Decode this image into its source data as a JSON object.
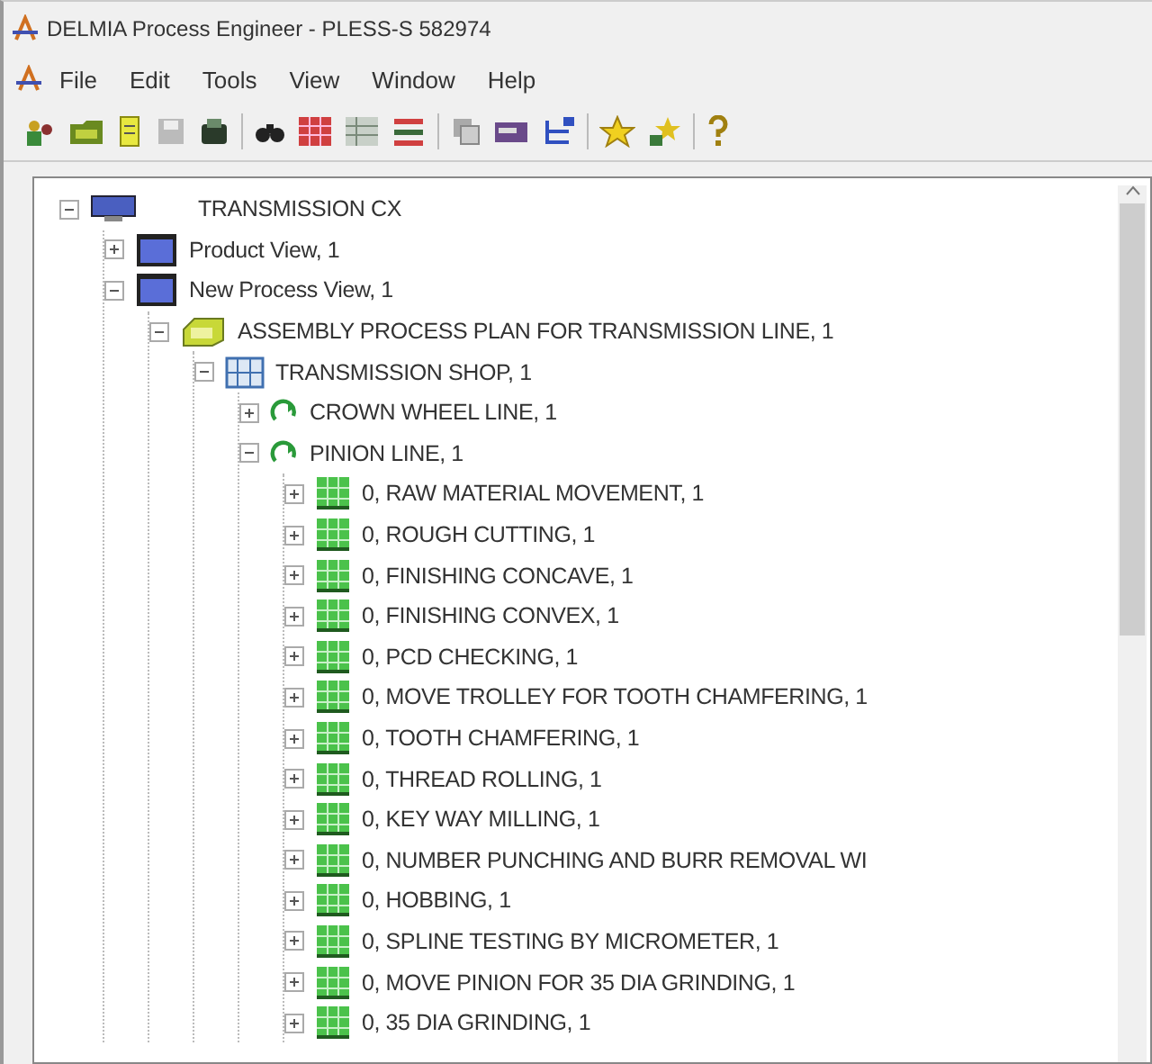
{
  "window": {
    "title": "DELMIA Process Engineer - PLESS-S 582974"
  },
  "menu": [
    {
      "label": "File"
    },
    {
      "label": "Edit"
    },
    {
      "label": "Tools"
    },
    {
      "label": "View"
    },
    {
      "label": "Window"
    },
    {
      "label": "Help"
    }
  ],
  "tree": [
    {
      "label": "TRANSMISSION CX",
      "kind": "root",
      "expanded": true,
      "children": [
        {
          "label": "Product View, 1",
          "kind": "folder",
          "expanded": false
        },
        {
          "label": "New Process View, 1",
          "kind": "folder",
          "expanded": true,
          "children": [
            {
              "label": "ASSEMBLY PROCESS PLAN FOR TRANSMISSION LINE, 1",
              "kind": "plan",
              "expanded": true,
              "children": [
                {
                  "label": "TRANSMISSION SHOP, 1",
                  "kind": "shop",
                  "expanded": true,
                  "children": [
                    {
                      "label": "CROWN WHEEL LINE, 1",
                      "kind": "line",
                      "expanded": false
                    },
                    {
                      "label": "PINION LINE, 1",
                      "kind": "line",
                      "expanded": true,
                      "children": [
                        {
                          "label": "0, RAW MATERIAL MOVEMENT, 1",
                          "kind": "operation",
                          "expanded": false
                        },
                        {
                          "label": "0, ROUGH CUTTING, 1",
                          "kind": "operation",
                          "expanded": false
                        },
                        {
                          "label": "0, FINISHING CONCAVE, 1",
                          "kind": "operation",
                          "expanded": false
                        },
                        {
                          "label": "0, FINISHING CONVEX, 1",
                          "kind": "operation",
                          "expanded": false
                        },
                        {
                          "label": "0, PCD CHECKING, 1",
                          "kind": "operation",
                          "expanded": false
                        },
                        {
                          "label": "0, MOVE TROLLEY FOR TOOTH CHAMFERING, 1",
                          "kind": "operation",
                          "expanded": false
                        },
                        {
                          "label": "0, TOOTH CHAMFERING, 1",
                          "kind": "operation",
                          "expanded": false
                        },
                        {
                          "label": "0, THREAD ROLLING, 1",
                          "kind": "operation",
                          "expanded": false
                        },
                        {
                          "label": "0, KEY WAY MILLING, 1",
                          "kind": "operation",
                          "expanded": false
                        },
                        {
                          "label": "0, NUMBER PUNCHING AND BURR REMOVAL WI",
                          "kind": "operation",
                          "expanded": false
                        },
                        {
                          "label": "0, HOBBING, 1",
                          "kind": "operation",
                          "expanded": false
                        },
                        {
                          "label": "0, SPLINE TESTING BY MICROMETER, 1",
                          "kind": "operation",
                          "expanded": false
                        },
                        {
                          "label": "0, MOVE PINION FOR 35 DIA GRINDING, 1",
                          "kind": "operation",
                          "expanded": false
                        },
                        {
                          "label": "0, 35 DIA GRINDING, 1",
                          "kind": "operation",
                          "expanded": false
                        }
                      ]
                    }
                  ]
                }
              ]
            }
          ]
        }
      ]
    }
  ]
}
